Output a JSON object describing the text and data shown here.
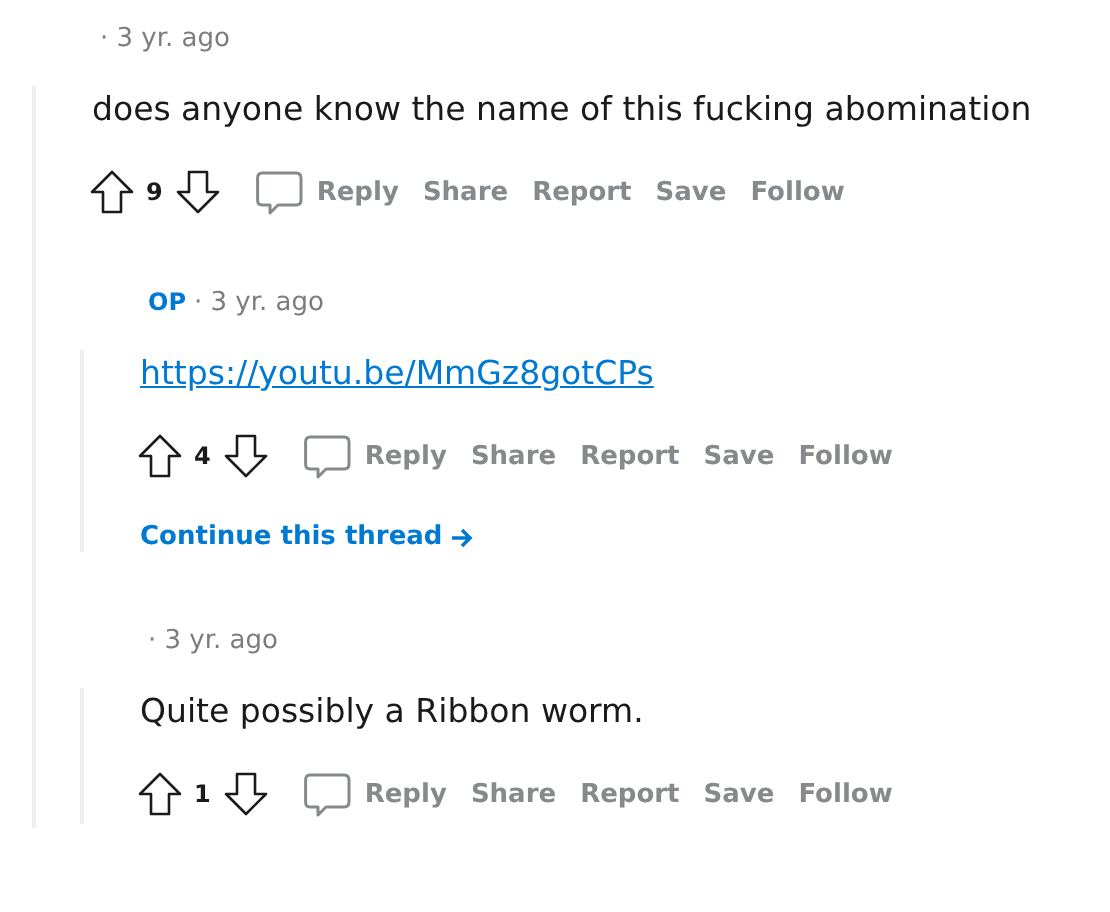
{
  "comments": [
    {
      "time": "· 3 yr. ago",
      "body": {
        "kind": "text",
        "text": "does anyone know the name of this fucking abomination"
      },
      "score": "9",
      "actions": [
        "Reply",
        "Share",
        "Report",
        "Save",
        "Follow"
      ],
      "children": [
        {
          "author": "OP",
          "time": "· 3 yr. ago",
          "body": {
            "kind": "link",
            "text": "https://youtu.be/MmGz8gotCPs"
          },
          "score": "4",
          "actions": [
            "Reply",
            "Share",
            "Report",
            "Save",
            "Follow"
          ],
          "continue_thread": "Continue this thread"
        },
        {
          "time": "· 3 yr. ago",
          "body": {
            "kind": "text",
            "text": "Quite possibly a Ribbon worm."
          },
          "score": "1",
          "actions": [
            "Reply",
            "Share",
            "Report",
            "Save",
            "Follow"
          ]
        }
      ]
    }
  ]
}
